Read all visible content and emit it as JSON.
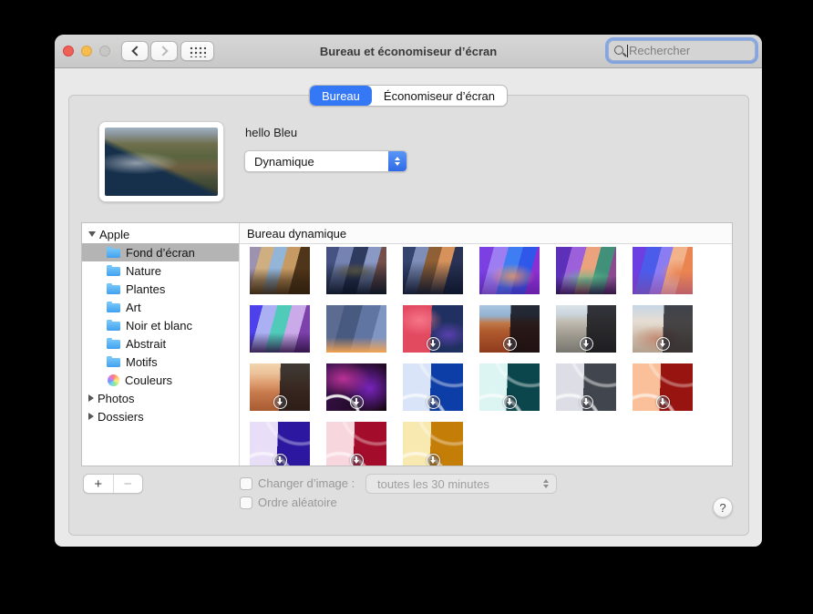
{
  "window": {
    "title": "Bureau et économiseur d’écran"
  },
  "search": {
    "placeholder": "Rechercher"
  },
  "icons": [
    "back-chevron-icon",
    "forward-chevron-icon",
    "show-all-grid-icon",
    "search-icon",
    "popup-stepper-icon",
    "disclosure-triangle-icon",
    "folder-icon",
    "color-wheel-icon",
    "download-badge-icon",
    "help-icon"
  ],
  "colors": {
    "accent": "#3478f6",
    "focus_ring": "rgba(72,131,241,0.55)",
    "sidebar_selection": "#b4b4b4",
    "titlebar": "#cfcfcf"
  },
  "tabs": [
    {
      "label": "Bureau",
      "selected": true
    },
    {
      "label": "Économiseur d’écran",
      "selected": false
    }
  ],
  "preview": {
    "name": "hello Bleu",
    "mode": "Dynamique",
    "bg": "radial-gradient(ellipse 50% 22% at 28% 52%, rgba(245,245,245,0.55), rgba(245,245,245,0) 75%), linear-gradient(205deg, rgba(10,30,52,0) 0% 52%, #16304c 58% 100%), linear-gradient(to bottom, #9fb2c2 0%, #8a949a 10%, #6f6f4c 24%, #5a6540 42%, #6e5f41 58%, #485038 76%, #333b2a 100%)"
  },
  "sidebar": {
    "groups": [
      {
        "label": "Apple",
        "expanded": true,
        "children": [
          {
            "label": "Fond d’écran",
            "icon": "folder",
            "selected": true
          },
          {
            "label": "Nature",
            "icon": "folder",
            "selected": false
          },
          {
            "label": "Plantes",
            "icon": "folder",
            "selected": false
          },
          {
            "label": "Art",
            "icon": "folder",
            "selected": false
          },
          {
            "label": "Noir et blanc",
            "icon": "folder",
            "selected": false
          },
          {
            "label": "Abstrait",
            "icon": "folder",
            "selected": false
          },
          {
            "label": "Motifs",
            "icon": "folder",
            "selected": false
          },
          {
            "label": "Couleurs",
            "icon": "color-wheel",
            "selected": false
          }
        ]
      },
      {
        "label": "Photos",
        "expanded": false,
        "children": []
      },
      {
        "label": "Dossiers",
        "expanded": false,
        "children": []
      }
    ]
  },
  "grid": {
    "header": "Bureau dynamique",
    "tiles": [
      {
        "name": "mojave",
        "badge": false,
        "bg": "linear-gradient(to top, rgba(46,30,14,0.92) 0%, rgba(46,30,14,0.55) 28%, rgba(46,30,14,0) 55%), linear-gradient(105deg, #9d93b0 0% 16%, #cfae81 16% 34%, #93b5d8 34% 52%, #c89a63 52% 70%, #4f3519 70% 100%)"
      },
      {
        "name": "catalina",
        "badge": false,
        "bg": "linear-gradient(to top, rgba(10,18,34,0.95) 0%, rgba(10,18,34,0.45) 40%, rgba(10,18,34,0) 68%), radial-gradient(ellipse 55% 26% at 48% 52%, rgba(125,115,75,0.85), rgba(125,115,75,0) 72%), linear-gradient(105deg, #465382 0% 18%, #7583b3 18% 38%, #2f3a5f 38% 58%, #8a98c4 58% 76%, #75504a 76% 100%)"
      },
      {
        "name": "big-sur",
        "badge": false,
        "bg": "linear-gradient(to top, rgba(13,21,42,0.95) 0%, rgba(13,21,42,0.4) 42%, rgba(13,21,42,0) 70%), linear-gradient(105deg, #35446f 0% 18%, #7e8eb8 18% 36%, #8f5f35 36% 54%, #d6925a 54% 72%, #2a3356 72% 100%)"
      },
      {
        "name": "cliffs-artistic",
        "badge": false,
        "bg": "radial-gradient(ellipse 55% 38% at 55% 62%, rgba(244,152,92,0.8), rgba(244,152,92,0) 70%), linear-gradient(to top, rgba(70,20,130,0.55) 0%, rgba(70,20,130,0) 50%), linear-gradient(105deg, #7c3fe2 0% 20%, #9c7ef2 20% 40%, #3f7ef2 40% 60%, #2f57ea 60% 80%, #8c2fd2 80% 100%)"
      },
      {
        "name": "lake-artistic",
        "badge": false,
        "bg": "linear-gradient(to top, rgba(35,16,55,0.85) 0%, rgba(35,16,55,0) 38%), radial-gradient(ellipse 62% 36% at 50% 72%, rgba(95,185,140,0.9), rgba(95,185,140,0) 75%), linear-gradient(105deg, #5d30ba 0% 22%, #9c60da 22% 42%, #eaa37c 42% 62%, #41917a 62% 82%, #8c4a91 82% 100%)"
      },
      {
        "name": "desert-artistic",
        "badge": false,
        "bg": "linear-gradient(to top, rgba(140,60,130,0.5) 0%, rgba(140,60,130,0) 48%), radial-gradient(ellipse 45% 40% at 78% 55%, rgba(234,131,79,0.9), rgba(234,131,79,0) 72%), linear-gradient(105deg, #6c3fe2 0% 20%, #4c5cea 20% 40%, #8c7cf2 40% 56%, #f2b28a 56% 76%, #ea8551 76% 100%)"
      },
      {
        "name": "beach-artistic",
        "badge": false,
        "bg": "linear-gradient(to top, rgba(42,16,62,0.88) 0%, rgba(42,16,62,0) 42%), linear-gradient(105deg, #4c41ea 0% 18%, #aab0f2 18% 38%, #50cbba 38% 58%, #cbaaea 58% 78%, #7c41aa 78% 100%)"
      },
      {
        "name": "solar-gradients",
        "badge": false,
        "bg": "linear-gradient(to top, #f2a252 0%, rgba(242,162,82,0) 32%), linear-gradient(105deg, #5c6c91 0% 25%, #485a7f 25% 50%, #6175a2 50% 75%, #7f95c2 75% 100%)"
      },
      {
        "name": "hello-abstract",
        "badge": true,
        "bg": "radial-gradient(ellipse 55% 45% at 28% 32%, rgba(250,125,145,0.85), rgba(250,125,145,0) 70%), radial-gradient(ellipse 48% 40% at 76% 62%, rgba(125,75,225,0.6), rgba(125,75,225,0) 72%), linear-gradient(92deg, #e24a60 0% 47%, #203060 47% 100%)"
      },
      {
        "name": "red-rock-desert",
        "badge": true,
        "bg": "linear-gradient(92deg, rgba(8,8,16,0) 0% 51%, rgba(8,8,16,0.82) 51% 100%), linear-gradient(to top, #8f3c1e 0%, #b05a2e 45%, #c07848 62%, #93b2d2 78%, #aac6e0 100%)"
      },
      {
        "name": "gray-rock",
        "badge": true,
        "bg": "linear-gradient(92deg, rgba(8,8,14,0) 0% 51%, rgba(8,8,14,0.8) 51% 100%), linear-gradient(to top, #77766f 0%, #a8a297 45%, #c0bcb2 65%, #ccd6de 82%, #dbe3ea 100%)"
      },
      {
        "name": "white-rocks",
        "badge": true,
        "bg": "linear-gradient(92deg, rgba(10,10,16,0) 0% 51%, rgba(10,10,16,0.72) 51% 100%), radial-gradient(ellipse 60% 40% at 40% 70%, rgba(190,100,70,0.55), rgba(190,100,70,0) 70%), linear-gradient(to top, #b3a08d 0%, #d6cabb 45%, #e6ddd2 65%, #c6d6e6 100%)"
      },
      {
        "name": "orange-rock",
        "badge": true,
        "bg": "linear-gradient(92deg, rgba(12,12,16,0) 0% 50%, rgba(12,12,16,0.78) 50% 100%), linear-gradient(to top, #a85a32 0%, #c97d4e 40%, #e0a073 60%, #ecc39b 80%, #f2d4ae 100%)"
      },
      {
        "name": "imac-pro-abstract",
        "badge": true,
        "bg": "radial-gradient(circle 40px at 18% 115%, rgba(0,0,0,0) 55%, rgba(255,255,255,0.9) 58% 63%, rgba(0,0,0,0) 66%), radial-gradient(ellipse 65% 55% at 28% 32%, rgba(232,62,182,0.75), rgba(232,62,182,0) 70%), radial-gradient(ellipse 60% 70% at 72% 52%, rgba(142,42,225,0.8), rgba(142,42,225,0) 75%), linear-gradient(120deg, #3c1252 0%, #150710 100%)"
      },
      {
        "name": "imac-blue",
        "badge": true,
        "bg": "radial-gradient(circle 52px at 22% 132%, rgba(255,255,255,0) 60%, rgba(255,255,255,0.65) 63% 67%, rgba(255,255,255,0) 70%), radial-gradient(circle 60px at 85% -30%, rgba(255,255,255,0) 62%, rgba(255,255,255,0.4) 65% 68%, rgba(255,255,255,0) 71%), linear-gradient(92deg, #d9e4f8 0% 46%, #0d3da6 46% 100%)"
      },
      {
        "name": "imac-teal",
        "badge": true,
        "bg": "radial-gradient(circle 52px at 22% 132%, rgba(255,255,255,0) 60%, rgba(255,255,255,0.65) 63% 67%, rgba(255,255,255,0) 70%), radial-gradient(circle 60px at 85% -30%, rgba(255,255,255,0) 62%, rgba(255,255,255,0.4) 65% 68%, rgba(255,255,255,0) 71%), linear-gradient(92deg, #dcf4f2 0% 46%, #0b464c 46% 100%)"
      },
      {
        "name": "imac-silver",
        "badge": true,
        "bg": "radial-gradient(circle 52px at 22% 132%, rgba(255,255,255,0) 60%, rgba(255,255,255,0.7) 63% 67%, rgba(255,255,255,0) 70%), radial-gradient(circle 60px at 85% -30%, rgba(255,255,255,0) 62%, rgba(255,255,255,0.45) 65% 68%, rgba(255,255,255,0) 71%), linear-gradient(92deg, #dddde6 0% 46%, #41454d 46% 100%)"
      },
      {
        "name": "imac-orange",
        "badge": true,
        "bg": "radial-gradient(circle 52px at 22% 132%, rgba(255,255,255,0) 60%, rgba(255,255,255,0.6) 63% 67%, rgba(255,255,255,0) 70%), radial-gradient(circle 60px at 85% -30%, rgba(255,255,255,0) 62%, rgba(255,255,255,0.35) 65% 68%, rgba(255,255,255,0) 71%), linear-gradient(92deg, #f9c09a 0% 46%, #981410 46% 100%)"
      },
      {
        "name": "imac-purple",
        "badge": true,
        "bg": "radial-gradient(circle 52px at 22% 132%, rgba(255,255,255,0) 60%, rgba(255,255,255,0.6) 63% 67%, rgba(255,255,255,0) 70%), radial-gradient(circle 60px at 85% -30%, rgba(255,255,255,0) 62%, rgba(255,255,255,0.35) 65% 68%, rgba(255,255,255,0) 71%), linear-gradient(92deg, #e9def8 0% 46%, #2b17a0 46% 100%)"
      },
      {
        "name": "imac-pink",
        "badge": true,
        "bg": "radial-gradient(circle 52px at 22% 132%, rgba(255,255,255,0) 60%, rgba(255,255,255,0.6) 63% 67%, rgba(255,255,255,0) 70%), radial-gradient(circle 60px at 85% -30%, rgba(255,255,255,0) 62%, rgba(255,255,255,0.35) 65% 68%, rgba(255,255,255,0) 71%), linear-gradient(92deg, #f8d6dd 0% 46%, #a30c2a 46% 100%)"
      },
      {
        "name": "imac-yellow",
        "badge": true,
        "bg": "radial-gradient(circle 52px at 22% 132%, rgba(255,255,255,0) 60%, rgba(255,255,255,0.6) 63% 67%, rgba(255,255,255,0) 70%), radial-gradient(circle 60px at 85% -30%, rgba(255,255,255,0) 62%, rgba(255,255,255,0.35) 65% 68%, rgba(255,255,255,0) 71%), linear-gradient(92deg, #f8e9b0 0% 46%, #c47d06 46% 100%)"
      }
    ]
  },
  "footer": {
    "add_label": "+",
    "remove_label": "−",
    "change_image_label": "Changer d’image :",
    "interval_value": "toutes les 30 minutes",
    "random_order_label": "Ordre aléatoire",
    "help_label": "?"
  }
}
